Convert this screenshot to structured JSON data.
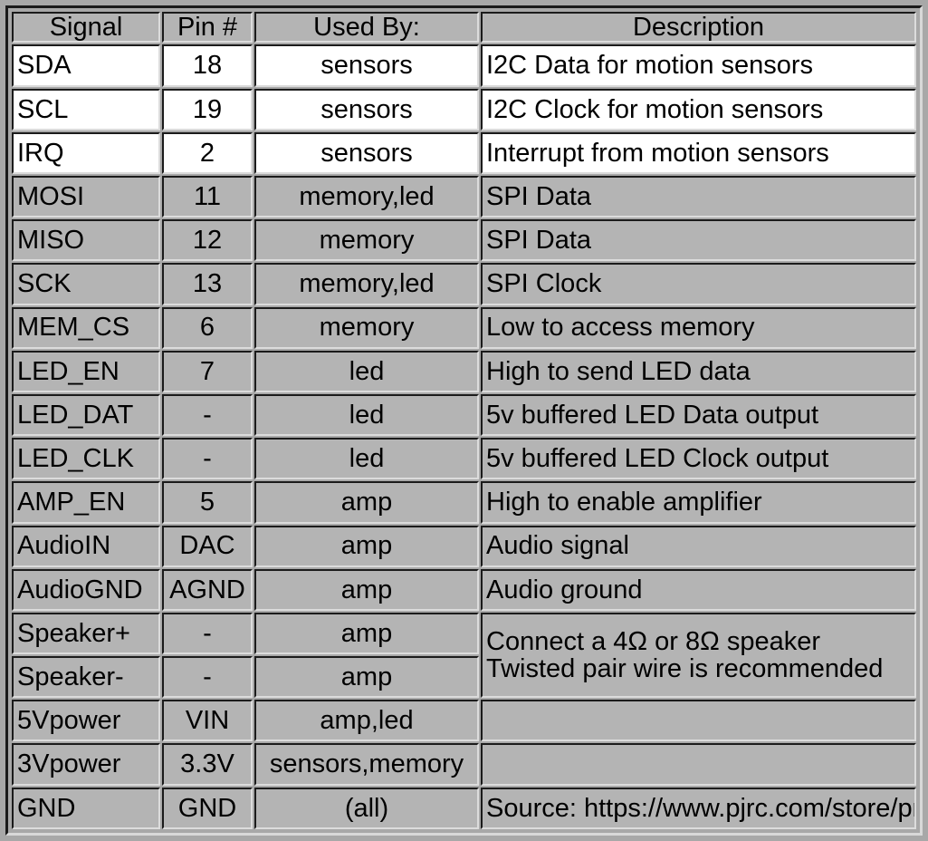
{
  "table": {
    "columns": [
      {
        "key": "signal",
        "label": "Signal"
      },
      {
        "key": "pin",
        "label": "Pin #"
      },
      {
        "key": "used_by",
        "label": "Used By:"
      },
      {
        "key": "description",
        "label": "Description"
      }
    ],
    "rows": [
      {
        "signal": "SDA",
        "pin": "18",
        "used_by": "sensors",
        "description": "I2C Data for motion sensors",
        "shade": "white"
      },
      {
        "signal": "SCL",
        "pin": "19",
        "used_by": "sensors",
        "description": "I2C Clock for motion sensors",
        "shade": "white"
      },
      {
        "signal": "IRQ",
        "pin": "2",
        "used_by": "sensors",
        "description": "Interrupt from motion sensors",
        "shade": "white"
      },
      {
        "signal": "MOSI",
        "pin": "11",
        "used_by": "memory,led",
        "description": "SPI Data",
        "shade": "gray"
      },
      {
        "signal": "MISO",
        "pin": "12",
        "used_by": "memory",
        "description": "SPI Data",
        "shade": "gray"
      },
      {
        "signal": "SCK",
        "pin": "13",
        "used_by": "memory,led",
        "description": "SPI Clock",
        "shade": "gray"
      },
      {
        "signal": "MEM_CS",
        "pin": "6",
        "used_by": "memory",
        "description": "Low to access memory",
        "shade": "gray"
      },
      {
        "signal": "LED_EN",
        "pin": "7",
        "used_by": "led",
        "description": "High to send LED data",
        "shade": "gray"
      },
      {
        "signal": "LED_DAT",
        "pin": "-",
        "used_by": "led",
        "description": "5v buffered LED Data output",
        "shade": "gray"
      },
      {
        "signal": "LED_CLK",
        "pin": "-",
        "used_by": "led",
        "description": "5v buffered LED Clock output",
        "shade": "gray"
      },
      {
        "signal": "AMP_EN",
        "pin": "5",
        "used_by": "amp",
        "description": "High to enable amplifier",
        "shade": "gray"
      },
      {
        "signal": "AudioIN",
        "pin": "DAC",
        "used_by": "amp",
        "description": "Audio signal",
        "shade": "gray"
      },
      {
        "signal": "AudioGND",
        "pin": "AGND",
        "used_by": "amp",
        "description": "Audio ground",
        "shade": "gray"
      },
      {
        "signal": "Speaker+",
        "pin": "-",
        "used_by": "amp",
        "description": "",
        "shade": "gray"
      },
      {
        "signal": "Speaker-",
        "pin": "-",
        "used_by": "amp",
        "description": "",
        "shade": "gray"
      },
      {
        "signal": "5Vpower",
        "pin": "VIN",
        "used_by": "amp,led",
        "description": "",
        "shade": "gray"
      },
      {
        "signal": "3Vpower",
        "pin": "3.3V",
        "used_by": "sensors,memory",
        "description": "",
        "shade": "gray"
      },
      {
        "signal": "GND",
        "pin": "GND",
        "used_by": "(all)",
        "description": "",
        "shade": "gray"
      }
    ],
    "merged_speaker_description": {
      "line1": "Connect a 4Ω or 8Ω speaker",
      "line2": "Twisted pair wire is recommended"
    },
    "source_note": "Source: https://www.pjrc.com/store/prop_shield.html"
  },
  "colors": {
    "page_background": "#a8a8a8",
    "gray_row": "#b4b4b4",
    "white_row": "#ffffff",
    "border_dark": "#1b1b1b",
    "border_light": "#dcdcdc",
    "text": "#000000"
  }
}
